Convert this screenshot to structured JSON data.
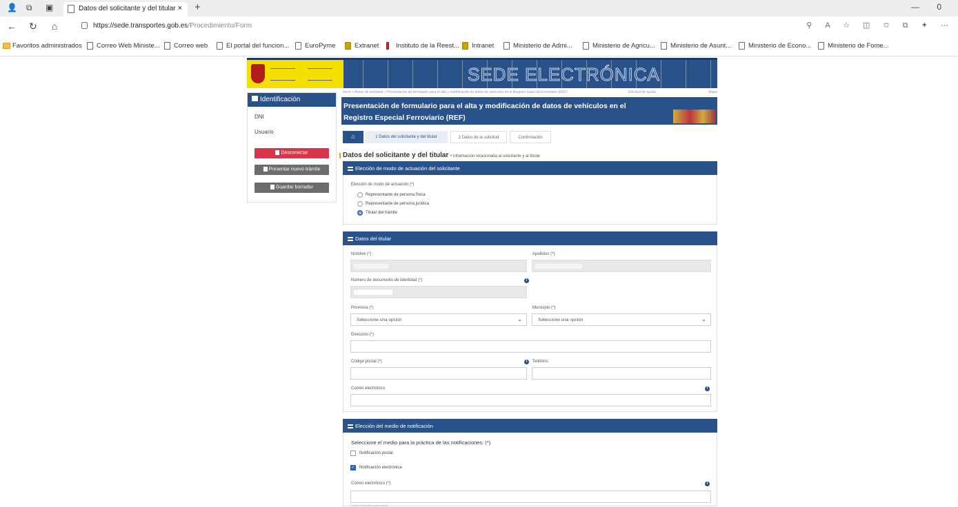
{
  "browser": {
    "tab_title": "Datos del solicitante y del titular",
    "tab_close": "×",
    "new_tab": "+",
    "url_host": "https://sede.transportes.gob.es",
    "url_path": "/Procedimiento/Form",
    "win_minimize": "—",
    "win_more": "0",
    "bookmarks": [
      "Favoritos administrados",
      "Correo Web Ministe...",
      "Correo web",
      "El portal del funcion...",
      "EuroPyme",
      "Extranet",
      "Instituto de la Reest...",
      "Intranet",
      "Ministerio de Admi...",
      "Ministerio de Agricu...",
      "Ministerio de Asunt...",
      "Ministerio de Econo...",
      "Ministerio de Fome..."
    ]
  },
  "header": {
    "sede_title": "SEDE ELECTRÓNICA"
  },
  "left_panel": {
    "title": "Identificación",
    "dni_label": "DNI",
    "user_label": "Usuario",
    "disconnect_label": "Desconectar",
    "new_procedure_label": "Presentar nuevo trámite",
    "save_draft_label": "Guardar borrador"
  },
  "breadcrumb": {
    "text": "Inicio > Áreas de actividad > Presentación de formulario para el alta y modificación de datos de vehículos en el Registro Especial Ferroviario (REF)",
    "help": "Solicitud de ayuda",
    "map": "Mapa"
  },
  "title": "Presentación de formulario para el alta y modificación de datos de vehículos en el Registro Especial Ferroviario (REF)",
  "steps": {
    "step1": "1 Datos del solicitante y del titular",
    "step2": "2 Datos de la solicitud",
    "step3": "Confirmación"
  },
  "section": {
    "title": "Datos del solicitante y del titular",
    "subtitle": "• Información relacionada al solicitante y al titular"
  },
  "modo": {
    "header": "Elección de modo de actuación del solicitante",
    "label": "Elección de modo de actuación (*)",
    "options": [
      "Representante de persona física",
      "Representante de persona jurídica",
      "Titular del trámite"
    ]
  },
  "titular": {
    "header": "Datos del titular",
    "nombre_label": "Nombre (*)",
    "apellidos_label": "Apellidos (*)",
    "documento_label": "Número de documento de identidad (*)",
    "provincia_label": "Provincia (*)",
    "provincia_value": "Seleccione una opción",
    "municipio_label": "Municipio (*)",
    "municipio_value": "Seleccione una opción",
    "direccion_label": "Dirección (*)",
    "cp_label": "Código postal (*)",
    "telefono_label": "Teléfono",
    "correo_label": "Correo electrónico",
    "info": "i"
  },
  "notificacion": {
    "header": "Elección del medio de notificación",
    "prompt": "Seleccione el medio para la práctica de las notificaciones: (*)",
    "postal": "Notificación postal",
    "electronica": "Notificación electrónica",
    "correo_label": "Correo electrónico (*)",
    "check": "✓",
    "note": "Correo informativo para avisos"
  },
  "colors": {
    "primary": "#29528b",
    "danger": "#d9344a",
    "secondary_btn": "#6c6c6c",
    "logo_yellow": "#f4e000"
  }
}
